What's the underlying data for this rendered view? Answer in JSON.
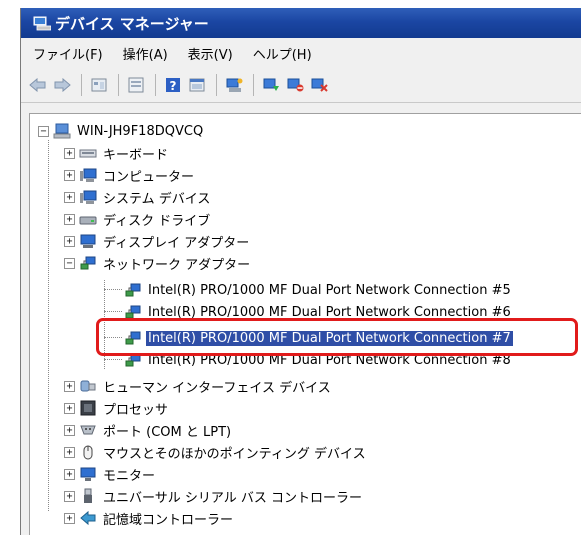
{
  "window": {
    "title": "デバイス マネージャー"
  },
  "menu": [
    "ファイル(F)",
    "操作(A)",
    "表示(V)",
    "ヘルプ(H)"
  ],
  "toolbar": [
    "back-icon",
    "forward-icon",
    "properties-view-icon",
    "show-hide-icon",
    "help-icon",
    "view-icon",
    "scan-icon",
    "update-driver-icon",
    "disable-icon",
    "uninstall-icon"
  ],
  "tree": {
    "computer": "WIN-JH9F18DQVCQ",
    "categories": {
      "keyboard": "キーボード",
      "computer": "コンピューター",
      "system_devices": "システム デバイス",
      "disk_drives": "ディスク ドライブ",
      "display_adapters": "ディスプレイ アダプター",
      "network_adapters": "ネットワーク アダプター",
      "hid": "ヒューマン インターフェイス デバイス",
      "processors": "プロセッサ",
      "ports": "ポート (COM と LPT)",
      "mice": "マウスとそのほかのポインティング デバイス",
      "monitors": "モニター",
      "usb": "ユニバーサル シリアル バス コントローラー",
      "storage": "記憶域コントローラー"
    },
    "network_devices": [
      "Intel(R) PRO/1000 MF Dual Port Network Connection #5",
      "Intel(R) PRO/1000 MF Dual Port Network Connection #6",
      "Intel(R) PRO/1000 MF Dual Port Network Connection #7",
      "Intel(R) PRO/1000 MF Dual Port Network Connection #8"
    ]
  },
  "colors": {
    "title_bar": "#1b46a3",
    "selection": "#2f4ea6",
    "highlight_border": "#e11b1b"
  }
}
